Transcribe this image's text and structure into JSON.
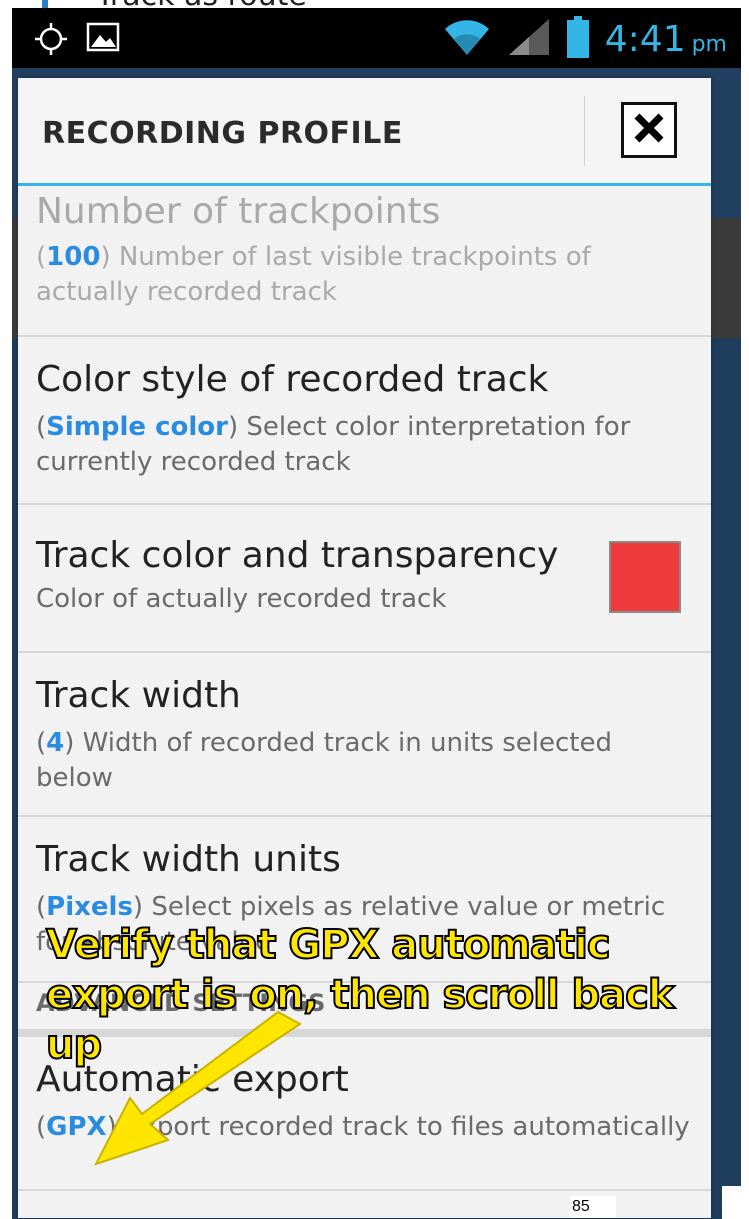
{
  "top_crop": {
    "label": "Track as route"
  },
  "status_bar": {
    "time": "4:41",
    "ampm": "pm",
    "icons": [
      "gps-icon",
      "image-icon",
      "wifi-icon",
      "signal-icon",
      "battery-icon"
    ]
  },
  "dialog": {
    "title": "RECORDING PROFILE",
    "close_icon": "close-icon",
    "items": [
      {
        "title": "Number of trackpoints",
        "value": "100",
        "desc": " Number of last visible trackpoints of actually recorded track"
      },
      {
        "title": "Color style of recorded track",
        "value": "Simple color",
        "desc": " Select color interpretation for currently recorded track"
      },
      {
        "title": "Track color and transparency",
        "desc": "Color of actually recorded track",
        "swatch_color": "#ef3b3b"
      },
      {
        "title": "Track width",
        "value": "4",
        "desc": " Width of recorded track in units selected below"
      },
      {
        "title": "Track width units",
        "value": "Pixels",
        "desc": " Select pixels as relative value or metric for absolute value"
      },
      {
        "title": "Automatic export",
        "value": "GPX",
        "desc": " Export recorded track to files automatically"
      }
    ],
    "section_header": "ADVANCED SETTINGS"
  },
  "annotation": {
    "text": "Verify that GPX automatic export is on, then scroll back up",
    "color": "#ffe600"
  },
  "page_number": "85",
  "colors": {
    "accent": "#33b5e5",
    "value": "#2a8ce0"
  }
}
